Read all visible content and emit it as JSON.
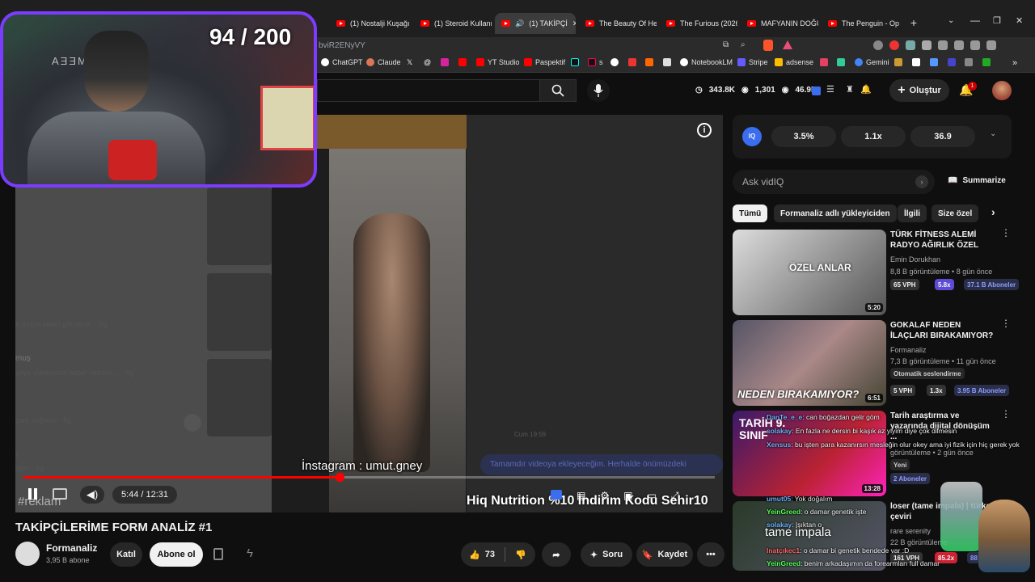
{
  "streamer": {
    "counter": "94 / 200",
    "brand": "AƎƎM"
  },
  "tabs": [
    {
      "label": "(1) Nostalji Kuşağı"
    },
    {
      "label": "(1) Steroid Kullanım"
    },
    {
      "label": "(1) TAKİPÇİ"
    },
    {
      "label": "The Beauty Of Her"
    },
    {
      "label": "The Furious (2026)"
    },
    {
      "label": "MAFYANIN DOĞUŞ"
    },
    {
      "label": "The Penguin - Ope"
    }
  ],
  "address": {
    "url": "bviR2ENyVY"
  },
  "bookmarks": [
    "ChatGPT",
    "Claude",
    "YT Studio",
    "Paspektif",
    "s",
    "NotebookLM",
    "Stripe",
    "adsense",
    "Gemini"
  ],
  "header": {
    "stats": [
      "343.8K",
      "1,301",
      "46.9K"
    ],
    "create_label": "Oluştur",
    "notif_count": "1"
  },
  "video": {
    "caption": "İnstagram : umut.gney",
    "ad_label": "#reklam",
    "promo": "Hiq Nutrition %10 İndirim Kodu Sehir10",
    "chat_overlay": "Tamamdır videoya ekleyeceğim. Herhalde önümüzdeki",
    "chat_time": "Cum 19:59",
    "chat_lines": [
      {
        "text": "e dosya ekleri gönderdi. · 6g"
      },
      {
        "text": "muş"
      },
      {
        "text": "yoyu yükleyince haber verrsini... · 6g"
      },
      {
        "text": "çam sağolun · 6g"
      },
      {
        "text": "y"
      },
      {
        "text": "olun · 6g"
      }
    ],
    "time": "5:44 / 12:31",
    "progress": 0.457
  },
  "meta": {
    "title": "TAKİPÇİLERİME FORM ANALİZ #1",
    "channel": "Formanaliz",
    "subs": "3,95 B abone",
    "join_label": "Katıl",
    "subscribe_label": "Abone ol",
    "likes": "73",
    "share_label": "",
    "ask_label": "Soru",
    "save_label": "Kaydet"
  },
  "vidiq": {
    "stats": [
      "3.5%",
      "1.1x",
      "36.9"
    ],
    "ask_placeholder": "Ask vidIQ",
    "summarize_label": "Summarize"
  },
  "chips": [
    "Tümü",
    "Formanaliz adlı yükleyiciden",
    "İlgili",
    "Size özel"
  ],
  "recs": [
    {
      "title": "TÜRK FİTNESS ALEMİ RADYO AĞIRLIK ÖZEL",
      "channel": "Emin Dorukhan",
      "views": "8,8 B görüntüleme • 8 gün önce",
      "vph": "65 VPH",
      "mult": "5.8x",
      "subs": "37.1 B Aboneler",
      "duration": "5:20",
      "thumb_text": "ÖZEL ANLAR"
    },
    {
      "title": "GOKALAF NEDEN İLAÇLARI BIRAKAMIYOR?",
      "channel": "Formanaliz",
      "views": "7,3 B görüntüleme • 11 gün önce",
      "extra": "Otomatik seslendirme",
      "vph": "5 VPH",
      "mult": "1.3x",
      "subs": "3.95 B Aboneler",
      "duration": "6:51",
      "thumb_text": "NEDEN BIRAKAMIYOR?"
    },
    {
      "title": "Tarih araştırma ve yazarında dijital dönüşüm ...",
      "channel": "",
      "views": "görüntüleme • 2 gün önce",
      "extra": "Yeni",
      "subs": "2 Aboneler",
      "duration": "13:28",
      "thumb_text": "TARİH 9. SINIF"
    },
    {
      "title": "loser (tame impala) | türkçe çeviri",
      "channel": "rare serenity",
      "views": "22 B görüntüleme",
      "vph": "161 VPH",
      "mult": "85.2x",
      "subs": "88 Abo",
      "duration": "",
      "thumb_text": "tame impala"
    }
  ],
  "chat": [
    {
      "user": "DanTe_e_e",
      "msg": ": can boğazdan gelir göm"
    },
    {
      "user": "solakay",
      "msg": ": En fazla ne dersin bi kaşık az yiyim diye çok dilmesin"
    },
    {
      "user": "Xensus",
      "msg": ": bu işten para kazanırsın mesleğin olur okey ama iyi fizik için hiç gerek yok"
    },
    {
      "user": "umut05",
      "msg": ": Yok doğalım"
    },
    {
      "user": "YeinGreed",
      "msg": ": o damar genetik işte"
    },
    {
      "user": "solakay",
      "msg": ": Işıktan o"
    },
    {
      "user": "Inatçıkec1",
      "msg": ": o damar bi genetik bendede var :D"
    },
    {
      "user": "YeinGreed",
      "msg": ": benim arkadaşımın da forearmları full damar"
    }
  ]
}
